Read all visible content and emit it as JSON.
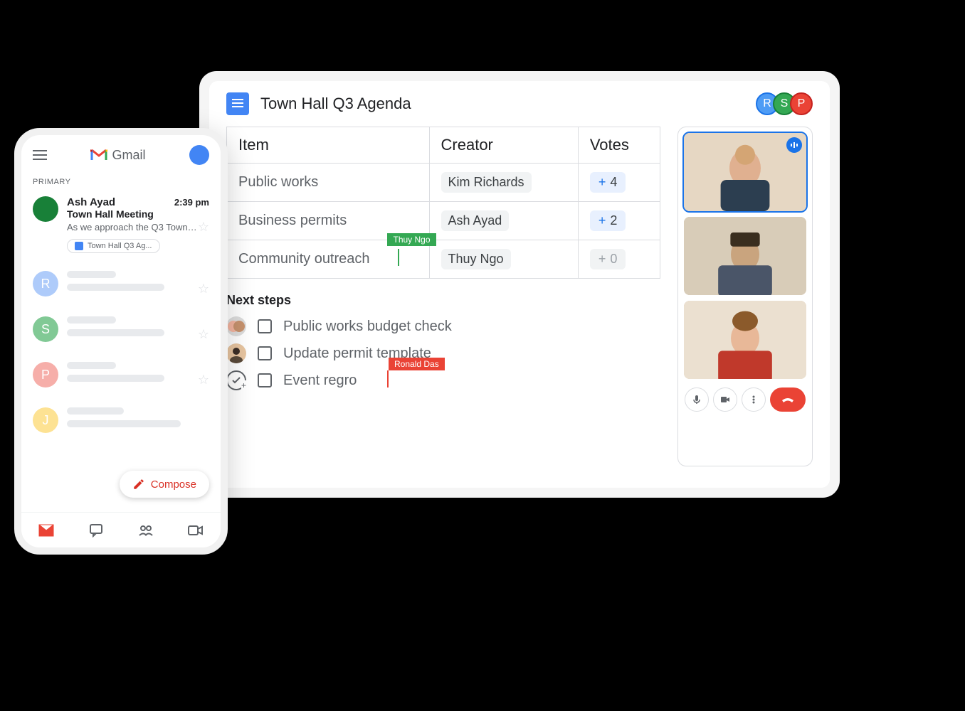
{
  "docs": {
    "title": "Town Hall Q3 Agenda",
    "collaborators": [
      {
        "initial": "R",
        "color_class": "av-r"
      },
      {
        "initial": "S",
        "color_class": "av-s"
      },
      {
        "initial": "P",
        "color_class": "av-p"
      }
    ],
    "table": {
      "headers": {
        "item": "Item",
        "creator": "Creator",
        "votes": "Votes"
      },
      "rows": [
        {
          "item": "Public works",
          "creator": "Kim Richards",
          "votes": "4",
          "vote_style": "blue"
        },
        {
          "item": "Business permits",
          "creator": "Ash Ayad",
          "votes": "2",
          "vote_style": "blue"
        },
        {
          "item": "Community outreach",
          "creator": "Thuy Ngo",
          "votes": "0",
          "vote_style": "gray"
        }
      ]
    },
    "cursors": {
      "green": {
        "name": "Thuy Ngo"
      },
      "red": {
        "name": "Ronald Das"
      }
    },
    "next_steps": {
      "title": "Next steps",
      "items": [
        {
          "text": "Public works budget check"
        },
        {
          "text": "Update permit template"
        },
        {
          "text": "Event regro"
        }
      ]
    }
  },
  "meet": {
    "controls": {
      "mic": "mic",
      "camera": "camera",
      "more": "more",
      "hangup": "hangup"
    }
  },
  "gmail": {
    "brand": "Gmail",
    "tab": "PRIMARY",
    "first_email": {
      "sender": "Ash Ayad",
      "time": "2:39 pm",
      "subject": "Town Hall Meeting",
      "preview": "As we approach the Q3 Town Ha...",
      "attachment": "Town Hall Q3 Ag..."
    },
    "placeholder_avatars": [
      "R",
      "S",
      "P",
      "J"
    ],
    "compose": "Compose"
  }
}
